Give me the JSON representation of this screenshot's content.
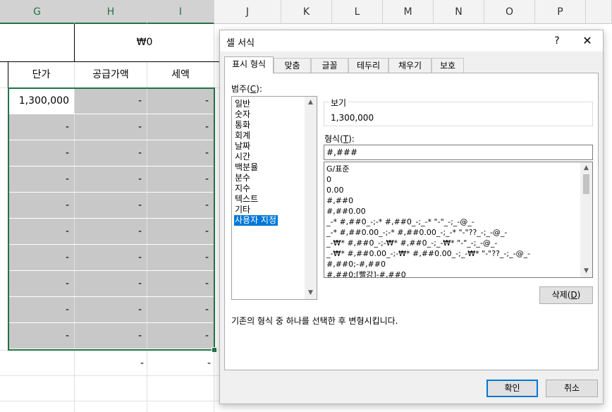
{
  "sheet": {
    "columns": [
      "G",
      "H",
      "I",
      "J",
      "K",
      "L",
      "M",
      "N",
      "O",
      "P"
    ],
    "merged_value": "₩0",
    "headers": {
      "unit_price": "단가",
      "supply_amount": "공급가액",
      "tax": "세액"
    },
    "first_row": {
      "unit_price": "1,300,000",
      "supply_amount": "-",
      "tax": "-"
    },
    "dash": "-",
    "total_row": {
      "supply_amount": "-",
      "tax": "-"
    }
  },
  "dialog": {
    "title": "셀 서식",
    "help": "?",
    "close": "✕",
    "tabs": [
      "표시 형식",
      "맞춤",
      "글꼴",
      "테두리",
      "채우기",
      "보호"
    ],
    "category_label": "범주(",
    "category_key": "C",
    "category_suffix": "):",
    "categories": [
      "일반",
      "숫자",
      "통화",
      "회계",
      "날짜",
      "시간",
      "백분율",
      "분수",
      "지수",
      "텍스트",
      "기타",
      "사용자 지정"
    ],
    "selected_category": "사용자 지정",
    "sample_label": "보기",
    "sample_value": "1,300,000",
    "type_label": "형식(",
    "type_key": "T",
    "type_suffix": "):",
    "type_value": "#,###",
    "formats": [
      "G/표준",
      "0",
      "0.00",
      "#,##0",
      "#,##0.00",
      "_-* #,##0_-;-* #,##0_-;_-* \"-\"_-;_-@_-",
      "_-* #,##0.00_-;-* #,##0.00_-;_-* \"-\"??_-;_-@_-",
      "_-₩* #,##0_-;-₩* #,##0_-;_-₩* \"-\"_-;_-@_-",
      "_-₩* #,##0.00_-;-₩* #,##0.00_-;_-₩* \"-\"??_-;_-@_-",
      "#,##0;-#,##0",
      "#,##0;[빨강]-#,##0"
    ],
    "delete_label": "삭제(",
    "delete_key": "D",
    "delete_suffix": ")",
    "description": "기존의 형식 중 하나를 선택한 후 변형시킵니다.",
    "ok": "확인",
    "cancel": "취소",
    "accent_color": "#0078d7"
  }
}
